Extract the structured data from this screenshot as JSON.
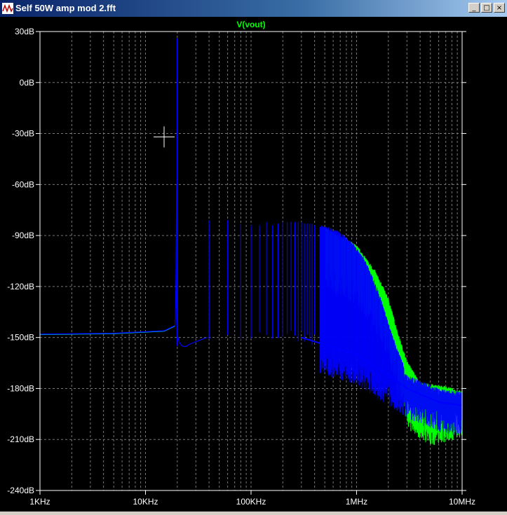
{
  "window": {
    "title": "Self 50W amp mod 2.fft",
    "buttons": {
      "minimize": "_",
      "maximize": "□",
      "close": "×"
    }
  },
  "chart_data": {
    "type": "line",
    "title": "V(vout)",
    "xscale": "log",
    "xlim": [
      1000,
      10000000
    ],
    "ylim": [
      -240,
      30
    ],
    "grid": true,
    "x_tick_labels": [
      "1KHz",
      "10KHz",
      "100KHz",
      "1MHz",
      "10MHz"
    ],
    "x_tick_values": [
      1000,
      10000,
      100000,
      1000000,
      10000000
    ],
    "y_tick_labels": [
      "30dB",
      "0dB",
      "-30dB",
      "-60dB",
      "-90dB",
      "-120dB",
      "-150dB",
      "-180dB",
      "-210dB",
      "-240dB"
    ],
    "y_tick_values": [
      30,
      0,
      -30,
      -60,
      -90,
      -120,
      -150,
      -180,
      -210,
      -240
    ],
    "colors": {
      "trace_blue": "#0000ff",
      "trace_green": "#00ff00",
      "title": "#00ff00",
      "grid": "#777777",
      "axis_text": "#ffffff",
      "cursor": "#ffffff"
    },
    "series": [
      {
        "name": "V(vout)",
        "color": "#0000ff",
        "noise_floor": [
          [
            1000,
            -148
          ],
          [
            5000,
            -147.5
          ],
          [
            15000,
            -146
          ],
          [
            19000,
            -143
          ]
        ],
        "fundamental": {
          "x": 20000,
          "y": 26
        },
        "harmonics": [
          [
            40000,
            -81
          ],
          [
            60000,
            -81
          ],
          [
            80000,
            -83
          ],
          [
            100000,
            -84
          ],
          [
            120000,
            -84
          ],
          [
            140000,
            -82
          ],
          [
            160000,
            -84
          ],
          [
            180000,
            -83
          ],
          [
            200000,
            -82
          ],
          [
            220000,
            -82
          ],
          [
            240000,
            -82
          ],
          [
            260000,
            -82
          ],
          [
            280000,
            -82
          ],
          [
            300000,
            -82
          ],
          [
            320000,
            -83
          ],
          [
            340000,
            -83
          ],
          [
            360000,
            -83
          ],
          [
            380000,
            -83
          ],
          [
            400000,
            -84
          ],
          [
            450000,
            -85
          ],
          [
            500000,
            -86
          ],
          [
            550000,
            -87
          ],
          [
            600000,
            -88
          ],
          [
            700000,
            -90
          ],
          [
            800000,
            -93
          ],
          [
            900000,
            -96
          ],
          [
            1000000,
            -99
          ],
          [
            1200000,
            -106
          ],
          [
            1400000,
            -115
          ],
          [
            1600000,
            -124
          ],
          [
            1800000,
            -134
          ],
          [
            2000000,
            -143
          ],
          [
            2400000,
            -158
          ],
          [
            2800000,
            -168
          ]
        ],
        "lower_envelope": [
          [
            300000,
            -150
          ],
          [
            1000000,
            -160
          ],
          [
            2000000,
            -172
          ],
          [
            3000000,
            -180
          ],
          [
            6000000,
            -188
          ],
          [
            10000000,
            -190
          ]
        ]
      },
      {
        "name": "",
        "color": "#00ff00",
        "envelope": [
          [
            500000,
            -87
          ],
          [
            1000000,
            -97
          ],
          [
            1500000,
            -112
          ],
          [
            2000000,
            -128
          ],
          [
            2500000,
            -150
          ],
          [
            3000000,
            -165
          ],
          [
            4000000,
            -178
          ],
          [
            7000000,
            -180
          ],
          [
            10000000,
            -183
          ]
        ],
        "floor": [
          [
            3000000,
            -190
          ],
          [
            5000000,
            -200
          ],
          [
            10000000,
            -195
          ]
        ]
      }
    ],
    "cursor": {
      "x": 15000,
      "y": -32
    }
  }
}
